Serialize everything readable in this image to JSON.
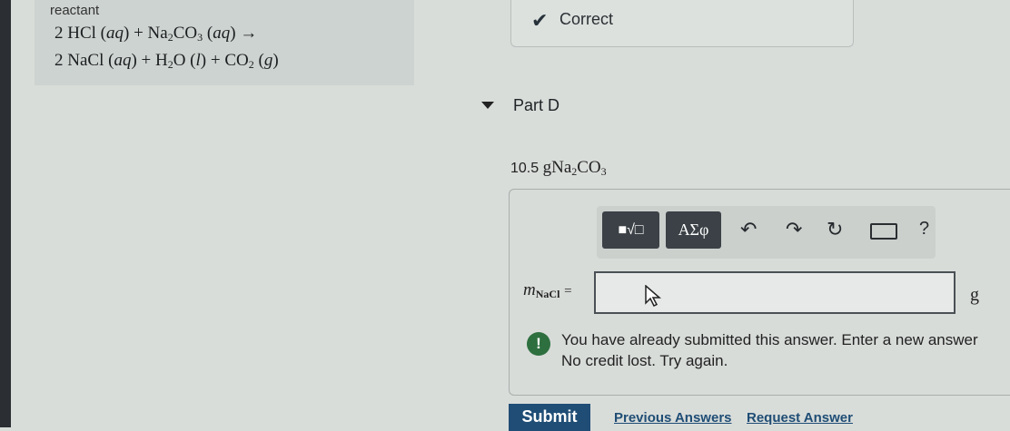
{
  "reactant": {
    "label": "reactant",
    "equation_line1": "2 HCl (aq) + Na2CO3 (aq) →",
    "equation_line2": "2 NaCl (aq) + H2O (l) + CO2 (g)"
  },
  "feedback": {
    "status_text": "Correct",
    "icon": "check-icon"
  },
  "part": {
    "title": "Part D",
    "given_value": "10.5",
    "given_unit": "g",
    "given_species": "Na2CO3"
  },
  "toolbar": {
    "templates_label": "■√□",
    "greek_label": "ΑΣφ",
    "undo": "↶",
    "redo": "↷",
    "reset": "↻",
    "help": "?"
  },
  "answer": {
    "variable": "m",
    "variable_subscript": "NaCl",
    "equals": "=",
    "value": "",
    "unit": "g"
  },
  "message": {
    "line1": "You have already submitted this answer. Enter a new answer",
    "line2": "No credit lost. Try again.",
    "icon": "!"
  },
  "actions": {
    "submit_label": "Submit",
    "previous_answers_label": "Previous Answers",
    "request_answer_label": "Request Answer"
  },
  "colors": {
    "accent": "#1f4d75",
    "alert": "#2e6f3f",
    "toolbar_button": "#3b4146"
  }
}
